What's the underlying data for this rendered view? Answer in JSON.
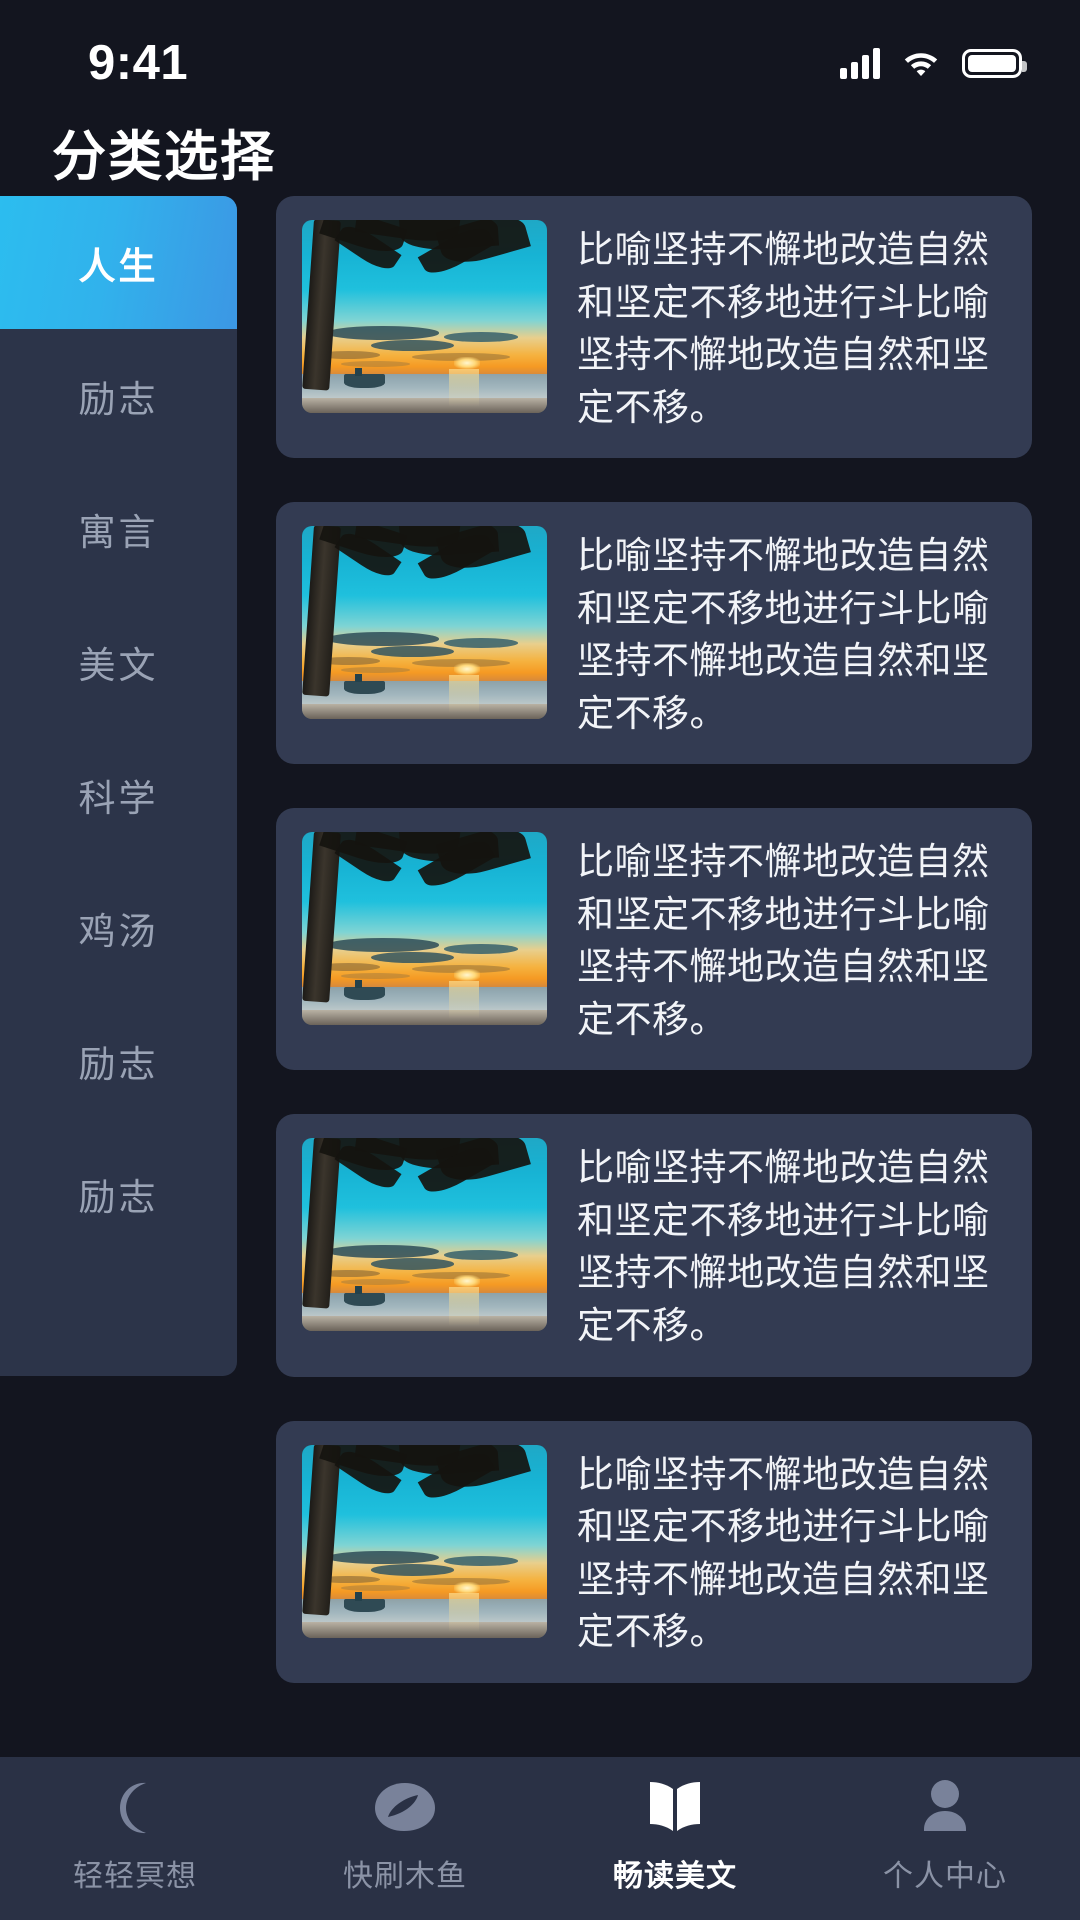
{
  "status_bar": {
    "time": "9:41",
    "signal_icon": "cellular-signal-icon",
    "wifi_icon": "wifi-icon",
    "battery_icon": "battery-icon"
  },
  "header": {
    "title": "分类选择"
  },
  "sidebar": {
    "items": [
      {
        "label": "人生",
        "active": true
      },
      {
        "label": "励志",
        "active": false
      },
      {
        "label": "寓言",
        "active": false
      },
      {
        "label": "美文",
        "active": false
      },
      {
        "label": "科学",
        "active": false
      },
      {
        "label": "鸡汤",
        "active": false
      },
      {
        "label": "励志",
        "active": false
      },
      {
        "label": "励志",
        "active": false
      }
    ]
  },
  "article_list": {
    "items": [
      {
        "text": "比喻坚持不懈地改造自然和坚定不移地进行斗比喻坚持不懈地改造自然和坚定不移。",
        "thumbnail": "tropical-sunset-beach-photo"
      },
      {
        "text": "比喻坚持不懈地改造自然和坚定不移地进行斗比喻坚持不懈地改造自然和坚定不移。",
        "thumbnail": "tropical-sunset-beach-photo"
      },
      {
        "text": "比喻坚持不懈地改造自然和坚定不移地进行斗比喻坚持不懈地改造自然和坚定不移。",
        "thumbnail": "tropical-sunset-beach-photo"
      },
      {
        "text": "比喻坚持不懈地改造自然和坚定不移地进行斗比喻坚持不懈地改造自然和坚定不移。",
        "thumbnail": "tropical-sunset-beach-photo"
      },
      {
        "text": "比喻坚持不懈地改造自然和坚定不移地进行斗比喻坚持不懈地改造自然和坚定不移。",
        "thumbnail": "tropical-sunset-beach-photo"
      }
    ]
  },
  "tab_bar": {
    "tabs": [
      {
        "label": "轻轻冥想",
        "icon": "moon-icon",
        "active": false
      },
      {
        "label": "快刷木鱼",
        "icon": "wooden-fish-icon",
        "active": false
      },
      {
        "label": "畅读美文",
        "icon": "open-book-icon",
        "active": true
      },
      {
        "label": "个人中心",
        "icon": "person-icon",
        "active": false
      }
    ]
  },
  "colors": {
    "background": "#13151f",
    "sidebar_bg": "#2c3449",
    "card_bg": "#333b52",
    "accent_gradient_from": "#2cbdef",
    "accent_gradient_to": "#3c97e4",
    "tabbar_bg": "#2a3145",
    "text_primary": "#ffffff",
    "text_muted": "#8b93a6"
  }
}
